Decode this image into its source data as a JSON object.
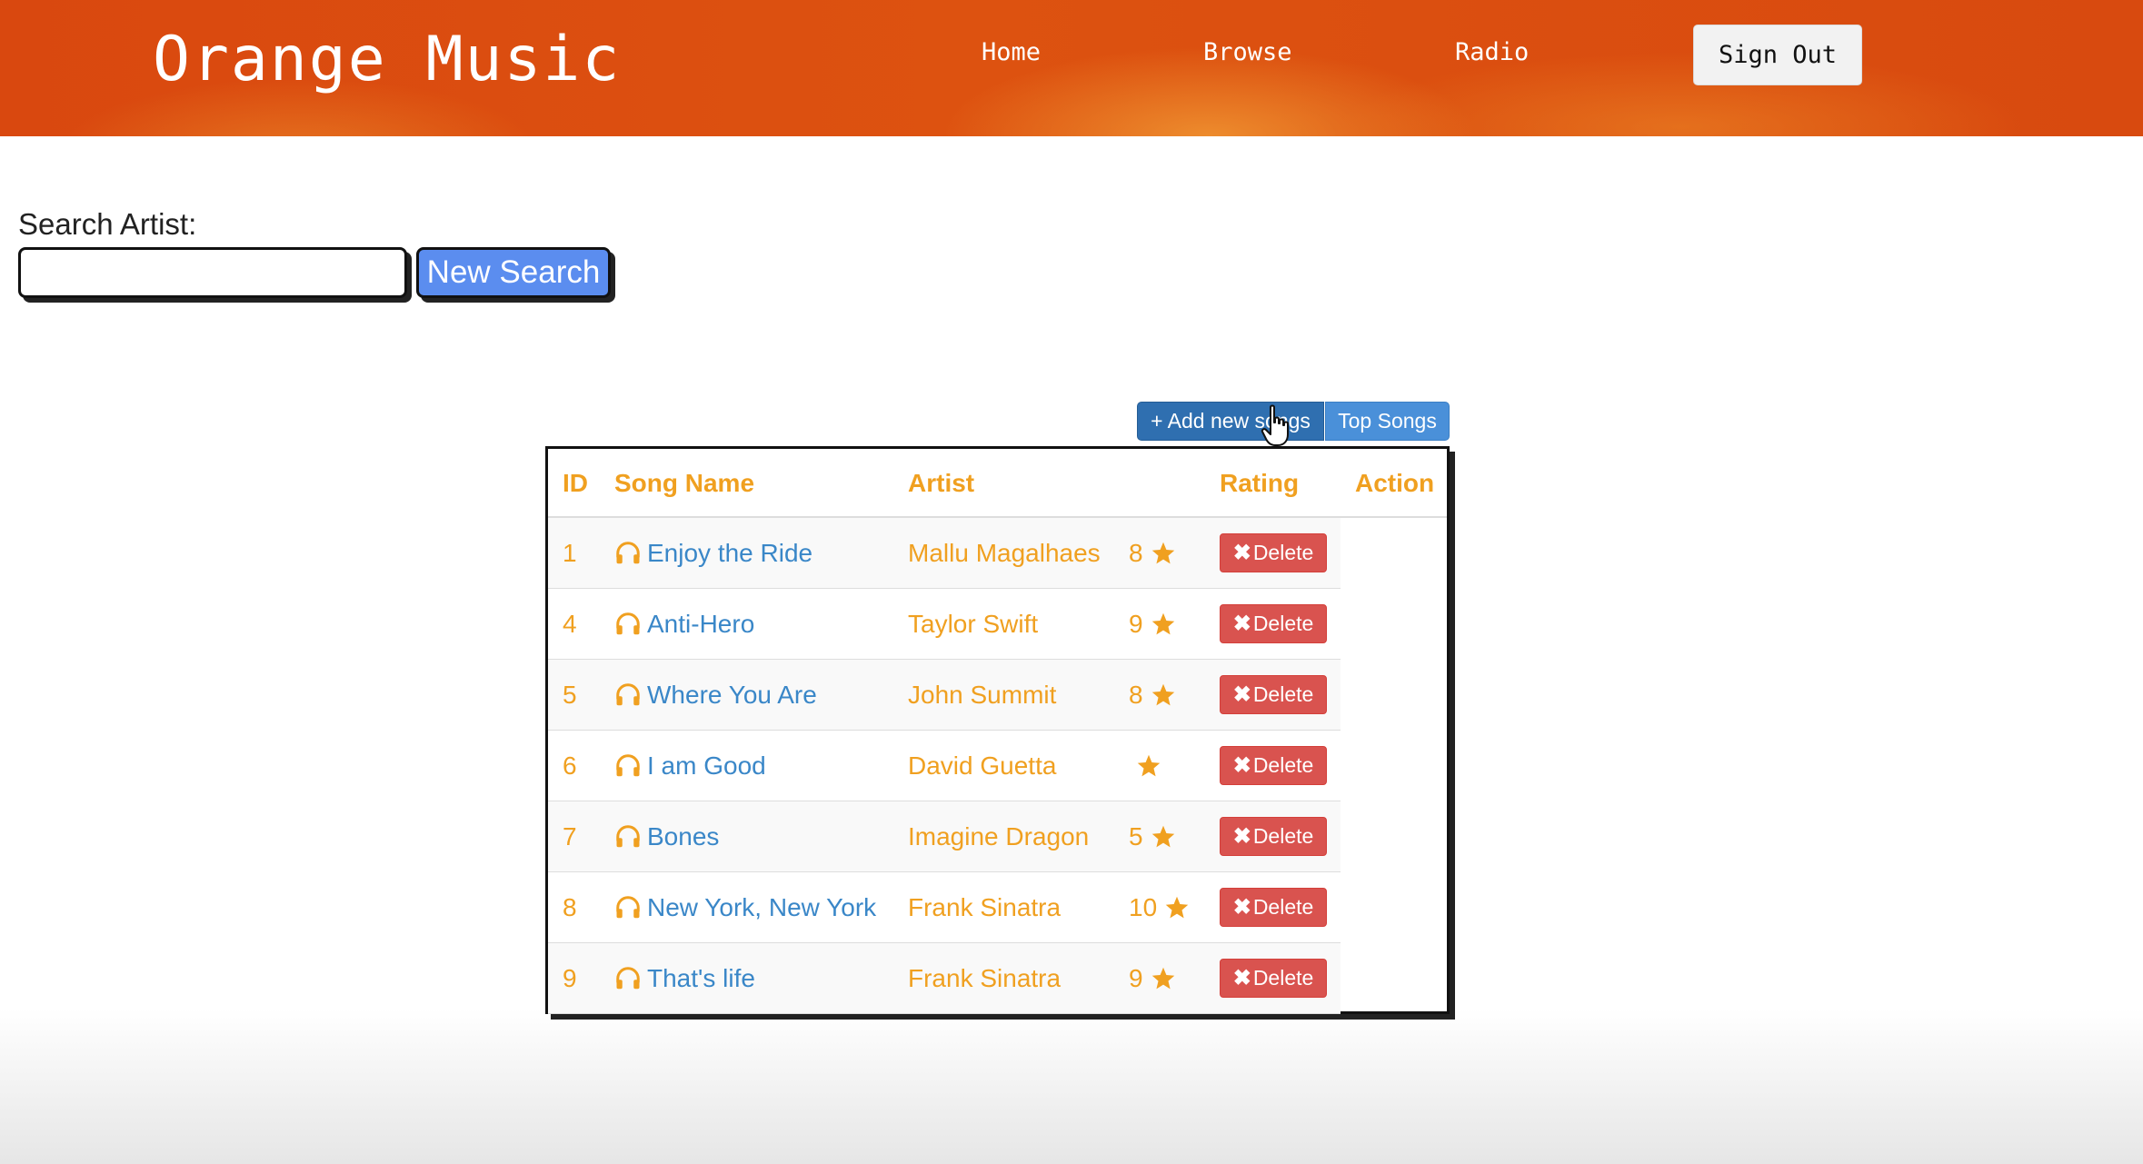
{
  "header": {
    "brand": "Orange Music",
    "nav": [
      {
        "label": "Home"
      },
      {
        "label": "Browse"
      },
      {
        "label": "Radio"
      }
    ],
    "sign_out_label": "Sign Out"
  },
  "search": {
    "label": "Search Artist:",
    "value": "",
    "placeholder": "",
    "button_label": "New Search"
  },
  "actions": {
    "add_label": "+ Add new songs",
    "top_label": "Top Songs"
  },
  "table": {
    "headers": {
      "id": "ID",
      "song": "Song Name",
      "artist": "Artist",
      "rating": "Rating",
      "action": "Action"
    },
    "delete_label": "Delete",
    "rows": [
      {
        "id": "1",
        "song": "Enjoy the Ride",
        "artist": "Mallu Magalhaes",
        "rating": "8"
      },
      {
        "id": "4",
        "song": "Anti-Hero",
        "artist": "Taylor Swift",
        "rating": "9"
      },
      {
        "id": "5",
        "song": "Where You Are",
        "artist": "John Summit",
        "rating": "8"
      },
      {
        "id": "6",
        "song": "I am Good",
        "artist": "David Guetta",
        "rating": ""
      },
      {
        "id": "7",
        "song": "Bones",
        "artist": "Imagine Dragon",
        "rating": "5"
      },
      {
        "id": "8",
        "song": "New York, New York",
        "artist": "Frank Sinatra",
        "rating": "10"
      },
      {
        "id": "9",
        "song": "That's life",
        "artist": "Frank Sinatra",
        "rating": "9"
      }
    ]
  },
  "colors": {
    "header_orange": "#d9480f",
    "accent_orange": "#f0a020",
    "link_blue": "#3a87c8",
    "delete_red": "#d9534f",
    "primary_blue": "#2f6fb0",
    "search_button_blue": "#5b8def"
  },
  "icons": {
    "song_icon": "headphones-icon",
    "rating_icon": "star-icon",
    "delete_icon": "x-icon",
    "pointer": "hand-cursor-icon"
  }
}
